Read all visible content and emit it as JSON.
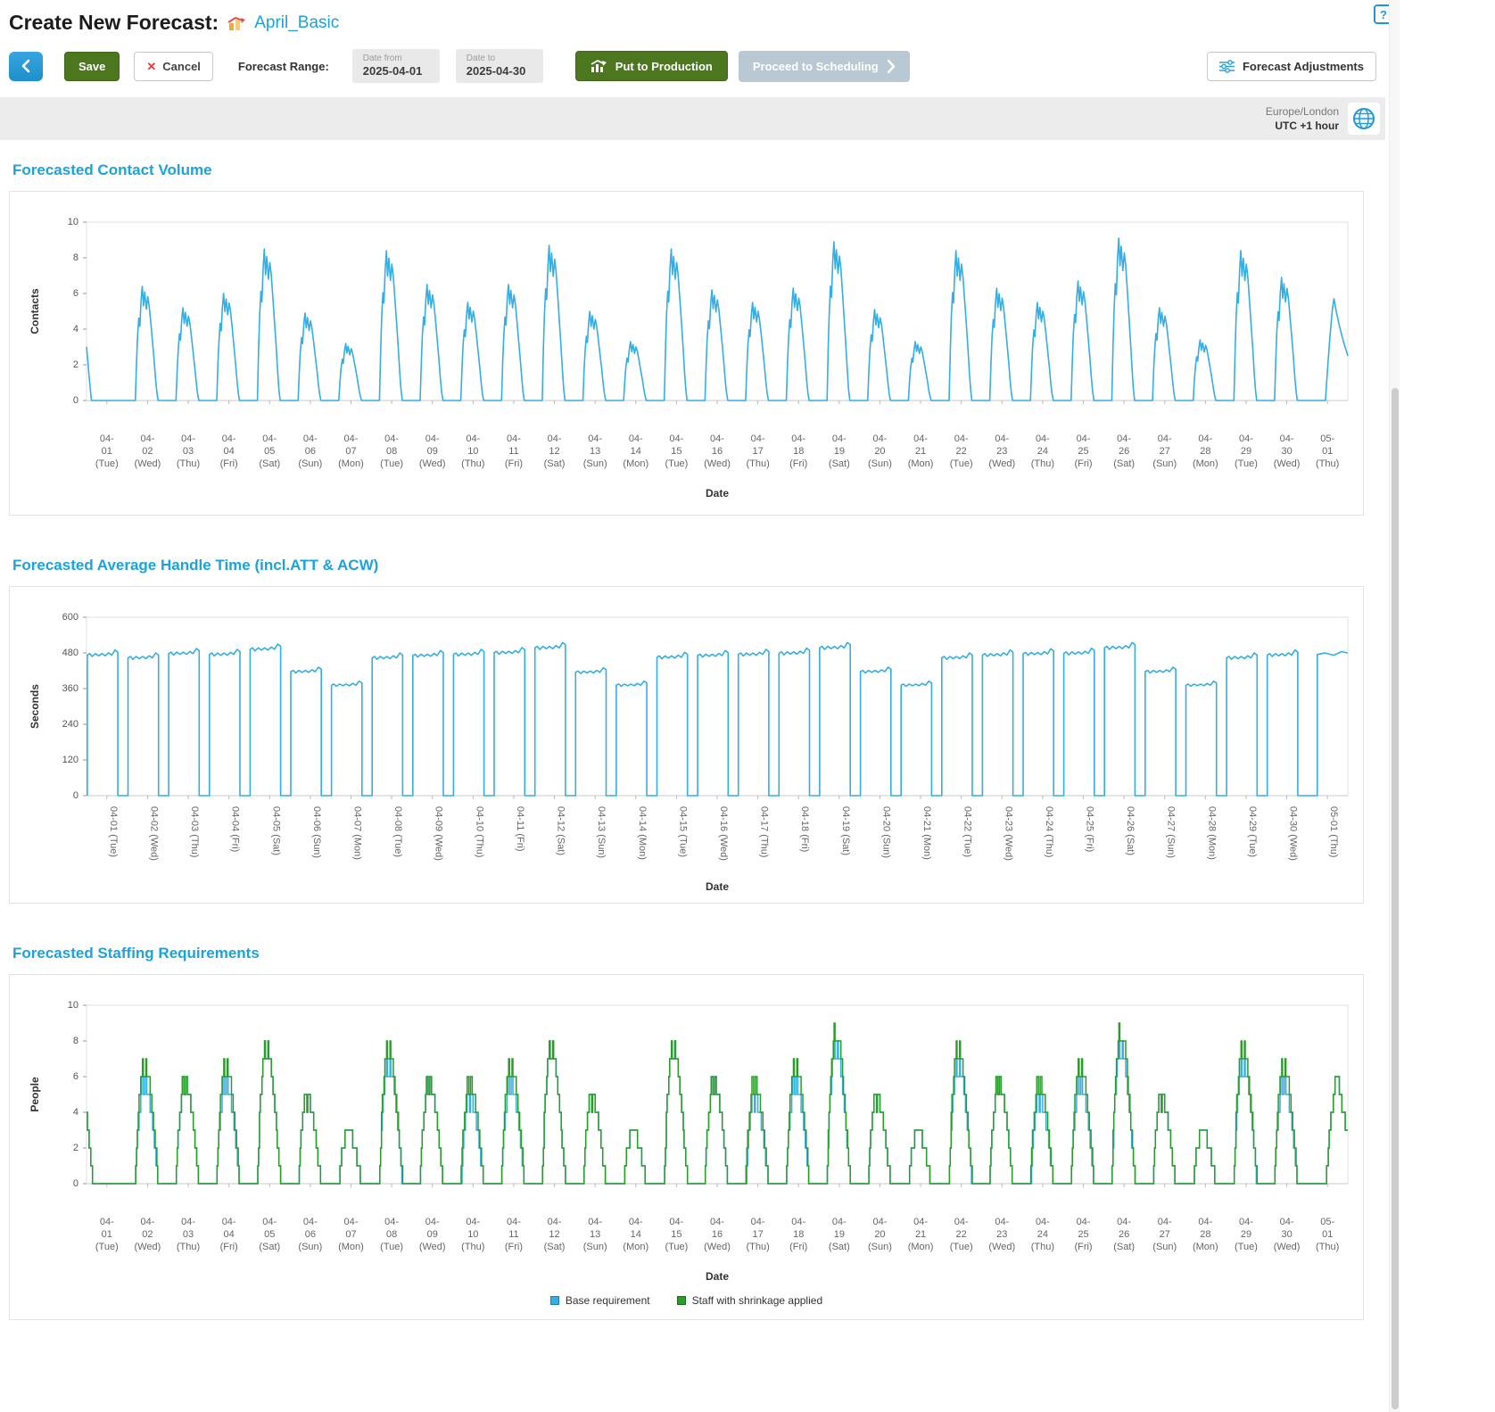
{
  "page": {
    "title": "Create New Forecast:",
    "forecast_name": "April_Basic",
    "help_icon": "?"
  },
  "icons": {
    "cancel_x": "✕"
  },
  "toolbar": {
    "save_label": "Save",
    "cancel_label": "Cancel",
    "forecast_range_label": "Forecast Range:",
    "date_from": {
      "label": "Date from",
      "value": "2025-04-01"
    },
    "date_to": {
      "label": "Date to",
      "value": "2025-04-30"
    },
    "put_to_production_label": "Put to Production",
    "proceed_to_scheduling_label": "Proceed to Scheduling",
    "forecast_adjustments_label": "Forecast Adjustments"
  },
  "timezone": {
    "region": "Europe/London",
    "offset": "UTC +1 hour"
  },
  "colors": {
    "accent_blue": "#1ba3db",
    "line_blue": "#35aee3",
    "line_green": "#2a9c2a",
    "button_green": "#4c771e",
    "disabled_button": "#b9c8d2"
  },
  "chart_data": [
    {
      "type": "line",
      "title": "Forecasted Contact Volume",
      "xlabel": "Date",
      "ylabel": "Contacts",
      "ylim": [
        0,
        10
      ],
      "yticks": [
        0,
        2,
        4,
        6,
        8,
        10
      ],
      "line_color": "#35aee3",
      "x_label_mode": "stacked",
      "grid": false,
      "categories": [
        "04-01 (Tue)",
        "04-02 (Wed)",
        "04-03 (Thu)",
        "04-04 (Fri)",
        "04-05 (Sat)",
        "04-06 (Sun)",
        "04-07 (Mon)",
        "04-08 (Tue)",
        "04-09 (Wed)",
        "04-10 (Thu)",
        "04-11 (Fri)",
        "04-12 (Sat)",
        "04-13 (Sun)",
        "04-14 (Mon)",
        "04-15 (Tue)",
        "04-16 (Wed)",
        "04-17 (Thu)",
        "04-18 (Fri)",
        "04-19 (Sat)",
        "04-20 (Sun)",
        "04-21 (Mon)",
        "04-22 (Tue)",
        "04-23 (Wed)",
        "04-24 (Thu)",
        "04-25 (Fri)",
        "04-26 (Sat)",
        "04-27 (Sun)",
        "04-28 (Mon)",
        "04-29 (Tue)",
        "04-30 (Wed)",
        "05-01 (Thu)"
      ],
      "daily_peaks": [
        3.0,
        6.4,
        5.2,
        6.0,
        8.5,
        4.9,
        3.2,
        8.4,
        6.5,
        5.5,
        6.5,
        8.7,
        5.0,
        3.3,
        8.5,
        6.2,
        5.5,
        6.3,
        8.9,
        5.1,
        3.3,
        8.4,
        6.3,
        5.5,
        6.7,
        9.1,
        5.2,
        3.4,
        8.4,
        6.9,
        5.7
      ],
      "intraday_shape": [
        [
          0.2,
          0
        ],
        [
          0.23,
          0.34
        ],
        [
          0.255,
          0.56
        ],
        [
          0.285,
          0.72
        ],
        [
          0.31,
          0.65
        ],
        [
          0.34,
          0.87
        ],
        [
          0.37,
          1.0
        ],
        [
          0.4,
          0.83
        ],
        [
          0.43,
          0.95
        ],
        [
          0.47,
          0.8
        ],
        [
          0.505,
          0.91
        ],
        [
          0.54,
          0.83
        ],
        [
          0.58,
          0.68
        ],
        [
          0.62,
          0.52
        ],
        [
          0.66,
          0.36
        ],
        [
          0.7,
          0.18
        ],
        [
          0.73,
          0.07
        ],
        [
          0.76,
          0
        ]
      ],
      "partial_start_shape": [
        [
          0,
          1
        ],
        [
          0.03,
          0.76
        ],
        [
          0.06,
          0.48
        ],
        [
          0.09,
          0.24
        ],
        [
          0.12,
          0
        ]
      ],
      "partial_end_shape": [
        [
          0.45,
          0
        ],
        [
          0.5,
          0.3
        ],
        [
          0.56,
          0.62
        ],
        [
          0.62,
          0.9
        ],
        [
          0.66,
          1.0
        ],
        [
          0.72,
          0.87
        ],
        [
          0.8,
          0.72
        ],
        [
          0.9,
          0.57
        ],
        [
          1,
          0.44
        ]
      ]
    },
    {
      "type": "line",
      "title": "Forecasted Average Handle Time (incl.ATT & ACW)",
      "xlabel": "Date",
      "ylabel": "Seconds",
      "ylim": [
        0,
        600
      ],
      "yticks": [
        0,
        120,
        240,
        360,
        480,
        600
      ],
      "line_color": "#35aee3",
      "x_label_mode": "rotated",
      "grid": false,
      "categories": [
        "04-01 (Tue)",
        "04-02 (Wed)",
        "04-03 (Thu)",
        "04-04 (Fri)",
        "04-05 (Sat)",
        "04-06 (Sun)",
        "04-07 (Mon)",
        "04-08 (Tue)",
        "04-09 (Wed)",
        "04-10 (Thu)",
        "04-11 (Fri)",
        "04-12 (Sat)",
        "04-13 (Sun)",
        "04-14 (Mon)",
        "04-15 (Tue)",
        "04-16 (Wed)",
        "04-17 (Thu)",
        "04-18 (Fri)",
        "04-19 (Sat)",
        "04-20 (Sun)",
        "04-21 (Mon)",
        "04-22 (Tue)",
        "04-23 (Wed)",
        "04-24 (Thu)",
        "04-25 (Fri)",
        "04-26 (Sat)",
        "04-27 (Sun)",
        "04-28 (Mon)",
        "04-29 (Tue)",
        "04-30 (Wed)",
        "05-01 (Thu)"
      ],
      "daily_values": [
        490,
        480,
        495,
        492,
        510,
        432,
        385,
        480,
        488,
        492,
        498,
        515,
        430,
        385,
        482,
        488,
        492,
        496,
        515,
        432,
        385,
        480,
        490,
        494,
        496,
        515,
        432,
        385,
        480,
        490,
        492
      ],
      "intraday_shape": [
        [
          0.02,
          0
        ],
        [
          0.02,
          0.965
        ],
        [
          0.08,
          0.975
        ],
        [
          0.14,
          0.955
        ],
        [
          0.22,
          0.975
        ],
        [
          0.3,
          0.96
        ],
        [
          0.38,
          0.975
        ],
        [
          0.46,
          0.96
        ],
        [
          0.54,
          0.98
        ],
        [
          0.62,
          0.965
        ],
        [
          0.7,
          1.0
        ],
        [
          0.77,
          0.985
        ],
        [
          0.77,
          0
        ]
      ],
      "partial_end_shape": [
        [
          0.25,
          0
        ],
        [
          0.25,
          0.965
        ],
        [
          0.45,
          0.975
        ],
        [
          0.65,
          0.96
        ],
        [
          0.85,
          0.985
        ],
        [
          1,
          0.975
        ]
      ]
    },
    {
      "type": "step",
      "title": "Forecasted Staffing Requirements",
      "xlabel": "Date",
      "ylabel": "People",
      "ylim": [
        0,
        10
      ],
      "yticks": [
        0,
        2,
        4,
        6,
        8,
        10
      ],
      "x_label_mode": "stacked",
      "grid": false,
      "legend_position": "bottom",
      "categories": [
        "04-01 (Tue)",
        "04-02 (Wed)",
        "04-03 (Thu)",
        "04-04 (Fri)",
        "04-05 (Sat)",
        "04-06 (Sun)",
        "04-07 (Mon)",
        "04-08 (Tue)",
        "04-09 (Wed)",
        "04-10 (Thu)",
        "04-11 (Fri)",
        "04-12 (Sat)",
        "04-13 (Sun)",
        "04-14 (Mon)",
        "04-15 (Tue)",
        "04-16 (Wed)",
        "04-17 (Thu)",
        "04-18 (Fri)",
        "04-19 (Sat)",
        "04-20 (Sun)",
        "04-21 (Mon)",
        "04-22 (Tue)",
        "04-23 (Wed)",
        "04-24 (Thu)",
        "04-25 (Fri)",
        "04-26 (Sat)",
        "04-27 (Sun)",
        "04-28 (Mon)",
        "04-29 (Tue)",
        "04-30 (Wed)",
        "05-01 (Thu)"
      ],
      "series": [
        {
          "name": "Base requirement",
          "color": "#35aee3",
          "daily_peaks": [
            4,
            6,
            6,
            6,
            8,
            5,
            3,
            7,
            6,
            5,
            6,
            8,
            5,
            3,
            8,
            6,
            5,
            6,
            8,
            5,
            3,
            7,
            6,
            5,
            6,
            8,
            5,
            3,
            7,
            6,
            6
          ]
        },
        {
          "name": "Staff with shrinkage applied",
          "color": "#2a9c2a",
          "daily_peaks": [
            4,
            7,
            6,
            7,
            8,
            5,
            3,
            8,
            6,
            6,
            7,
            8,
            5,
            3,
            8,
            6,
            6,
            7,
            9,
            5,
            3,
            8,
            6,
            6,
            7,
            9,
            5,
            3,
            8,
            7,
            6
          ]
        }
      ],
      "intraday_shape": [
        [
          0.2,
          0
        ],
        [
          0.24,
          0.4
        ],
        [
          0.28,
          0.62
        ],
        [
          0.33,
          0.8
        ],
        [
          0.37,
          1.0
        ],
        [
          0.41,
          0.86
        ],
        [
          0.45,
          0.95
        ],
        [
          0.5,
          0.88
        ],
        [
          0.55,
          0.78
        ],
        [
          0.6,
          0.62
        ],
        [
          0.65,
          0.45
        ],
        [
          0.7,
          0.25
        ],
        [
          0.745,
          0.08
        ],
        [
          0.78,
          0
        ]
      ],
      "partial_start_shape": [
        [
          0,
          1
        ],
        [
          0.04,
          0.7
        ],
        [
          0.08,
          0.42
        ],
        [
          0.12,
          0.18
        ],
        [
          0.15,
          0
        ]
      ],
      "partial_end_shape": [
        [
          0.45,
          0
        ],
        [
          0.52,
          0.35
        ],
        [
          0.6,
          0.65
        ],
        [
          0.68,
          0.95
        ],
        [
          0.74,
          1.0
        ],
        [
          0.82,
          0.8
        ],
        [
          0.92,
          0.6
        ],
        [
          1,
          0.45
        ]
      ]
    }
  ]
}
